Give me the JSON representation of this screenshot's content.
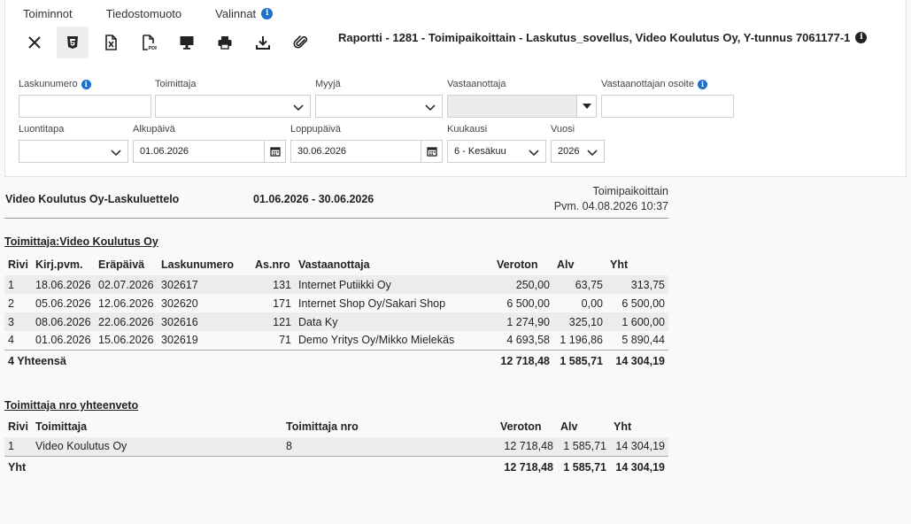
{
  "menu": {
    "toiminnot": "Toiminnot",
    "tiedostomuoto": "Tiedostomuoto",
    "valinnat": "Valinnat"
  },
  "toolbar": {
    "icons": [
      "close-icon",
      "html5-icon",
      "excel-file-icon",
      "pdf-file-icon",
      "monitor-icon",
      "printer-icon",
      "download-icon",
      "paperclip-icon"
    ]
  },
  "report_title": "Raportti - 1281 - Toimipaikoittain - Laskutus_sovellus, Video Koulutus Oy, Y-tunnus 7061177-1",
  "filters": {
    "laskunumero": {
      "label": "Laskunumero",
      "value": ""
    },
    "toimittaja": {
      "label": "Toimittaja",
      "value": ""
    },
    "myyja": {
      "label": "Myyjä",
      "value": ""
    },
    "vastaanottaja": {
      "label": "Vastaanottaja",
      "value": ""
    },
    "vastaanottajan_osoite": {
      "label": "Vastaanottajan osoite",
      "value": ""
    },
    "luontitapa": {
      "label": "Luontitapa",
      "value": ""
    },
    "alkupaiva": {
      "label": "Alkupäivä",
      "value": "01.06.2026"
    },
    "loppupaiva": {
      "label": "Loppupäivä",
      "value": "30.06.2026"
    },
    "kuukausi": {
      "label": "Kuukausi",
      "value": "6 - Kesäkuu"
    },
    "vuosi": {
      "label": "Vuosi",
      "value": "2026"
    }
  },
  "report": {
    "company_list": "Video Koulutus Oy-Laskuluettelo",
    "date_from": "01.06.2026",
    "date_sep": "-",
    "date_to": "30.06.2026",
    "grouping": "Toimipaikoittain",
    "printed": "Pvm. 04.08.2026 10:37"
  },
  "section1": {
    "title": "Toimittaja:Video Koulutus Oy",
    "headers": [
      "Rivi",
      "Kirj.pvm.",
      "Eräpäivä",
      "Laskunumero",
      "As.nro",
      "Vastaanottaja",
      "Veroton",
      "Alv",
      "Yht"
    ],
    "rows": [
      [
        "1",
        "18.06.2026",
        "02.07.2026",
        "302617",
        "131",
        "Internet Putiikki Oy",
        "250,00",
        "63,75",
        "313,75"
      ],
      [
        "2",
        "05.06.2026",
        "12.06.2026",
        "302620",
        "171",
        "Internet Shop Oy/Sakari Shop",
        "6 500,00",
        "0,00",
        "6 500,00"
      ],
      [
        "3",
        "08.06.2026",
        "22.06.2026",
        "302616",
        "121",
        "Data Ky",
        "1 274,90",
        "325,10",
        "1 600,00"
      ],
      [
        "4",
        "01.06.2026",
        "15.06.2026",
        "302619",
        "71",
        "Demo Yritys Oy/Mikko Mielekäs",
        "4 693,58",
        "1 196,86",
        "5 890,44"
      ]
    ],
    "total_label": "4 Yhteensä",
    "total_veroton": "12 718,48",
    "total_alv": "1 585,71",
    "total_yht": "14 304,19"
  },
  "section2": {
    "title": "Toimittaja nro yhteenveto",
    "headers": [
      "Rivi",
      "Toimittaja",
      "Toimittaja nro",
      "Veroton",
      "Alv",
      "Yht"
    ],
    "rows": [
      [
        "1",
        "Video Koulutus Oy",
        "8",
        "12 718,48",
        "1 585,71",
        "14 304,19"
      ]
    ],
    "total_label": "Yht",
    "total_veroton": "12 718,48",
    "total_alv": "1 585,71",
    "total_yht": "14 304,19"
  },
  "colors": {
    "info_blue": "#1e6fc9",
    "row_stripe": "#ececec"
  }
}
